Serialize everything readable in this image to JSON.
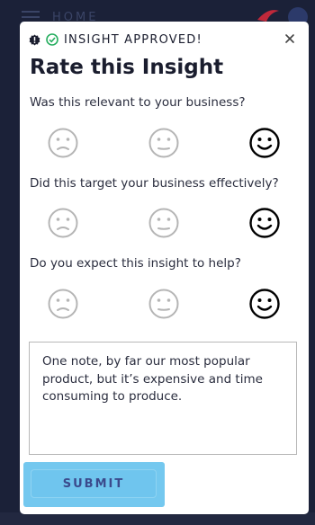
{
  "background": {
    "title": "HOME"
  },
  "modal": {
    "status_text": "INSIGHT APPROVED!",
    "title": "Rate this Insight",
    "questions": [
      {
        "text": "Was this relevant to your business?",
        "selected": "happy"
      },
      {
        "text": "Did this target your business effectively?",
        "selected": "happy"
      },
      {
        "text": "Do you expect this insight to help?",
        "selected": "happy"
      }
    ],
    "rating_options": [
      "sad",
      "neutral",
      "happy"
    ],
    "notes_value": "One note, by far our most popular product, but it’s expensive and time consuming to produce.",
    "submit_label": "SUBMIT"
  },
  "colors": {
    "background": "#1b2138",
    "accent": "#74c8ef",
    "submit_text": "#3b4a8c",
    "approved_check": "#27ae60",
    "inactive_face": "#b5b5b5",
    "selected_face": "#000000"
  },
  "icons": {
    "status_badge": "badge-alert-icon",
    "approved": "check-circle-icon",
    "close": "close-icon",
    "rating_sad": "sad-face-icon",
    "rating_neutral": "neutral-face-icon",
    "rating_happy": "happy-face-icon"
  }
}
